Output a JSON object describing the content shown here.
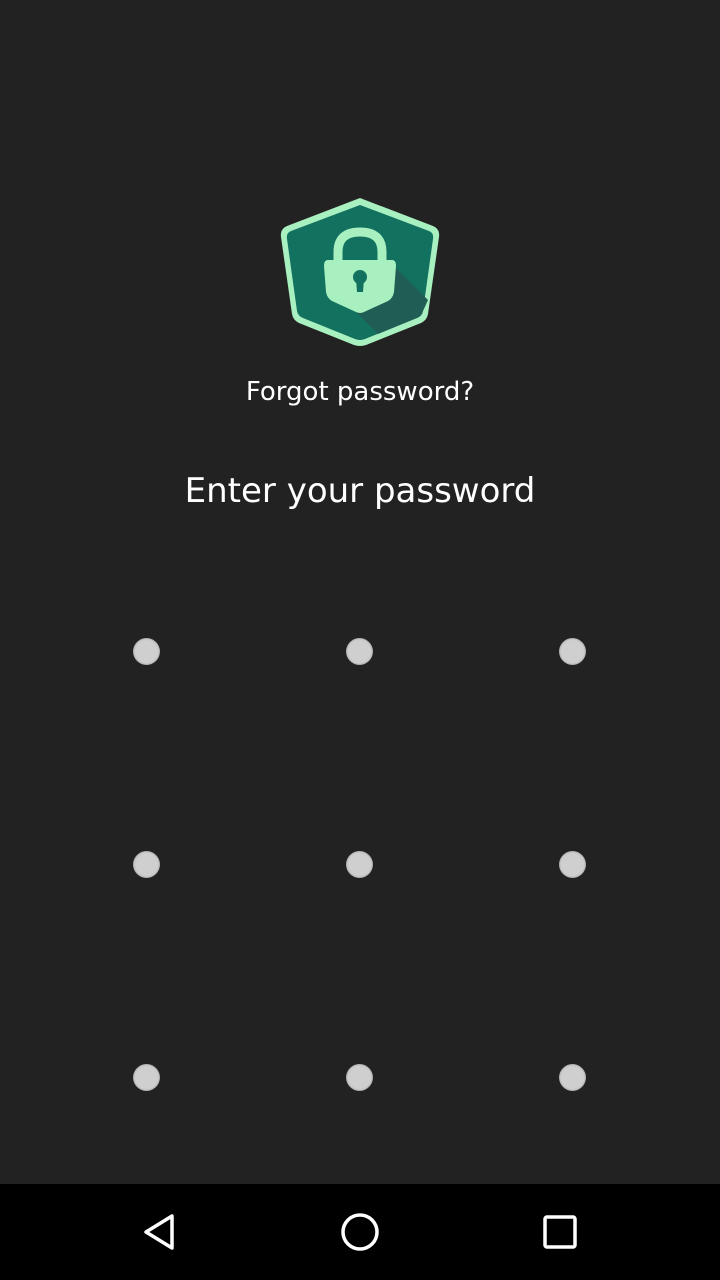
{
  "lock_screen": {
    "forgot_password_label": "Forgot password?",
    "prompt": "Enter your password"
  },
  "pattern": {
    "rows": 3,
    "columns": 3,
    "dot_color": "#cfcfcf"
  },
  "colors": {
    "background": "#222222",
    "logo_outer": "#a8f0c0",
    "logo_inner": "#13715f",
    "logo_shadow": "#205e55",
    "navbar": "#000000"
  },
  "icons": {
    "app_logo": "shield-lock-icon",
    "back": "back-triangle-icon",
    "home": "home-circle-icon",
    "recents": "recents-square-icon"
  }
}
